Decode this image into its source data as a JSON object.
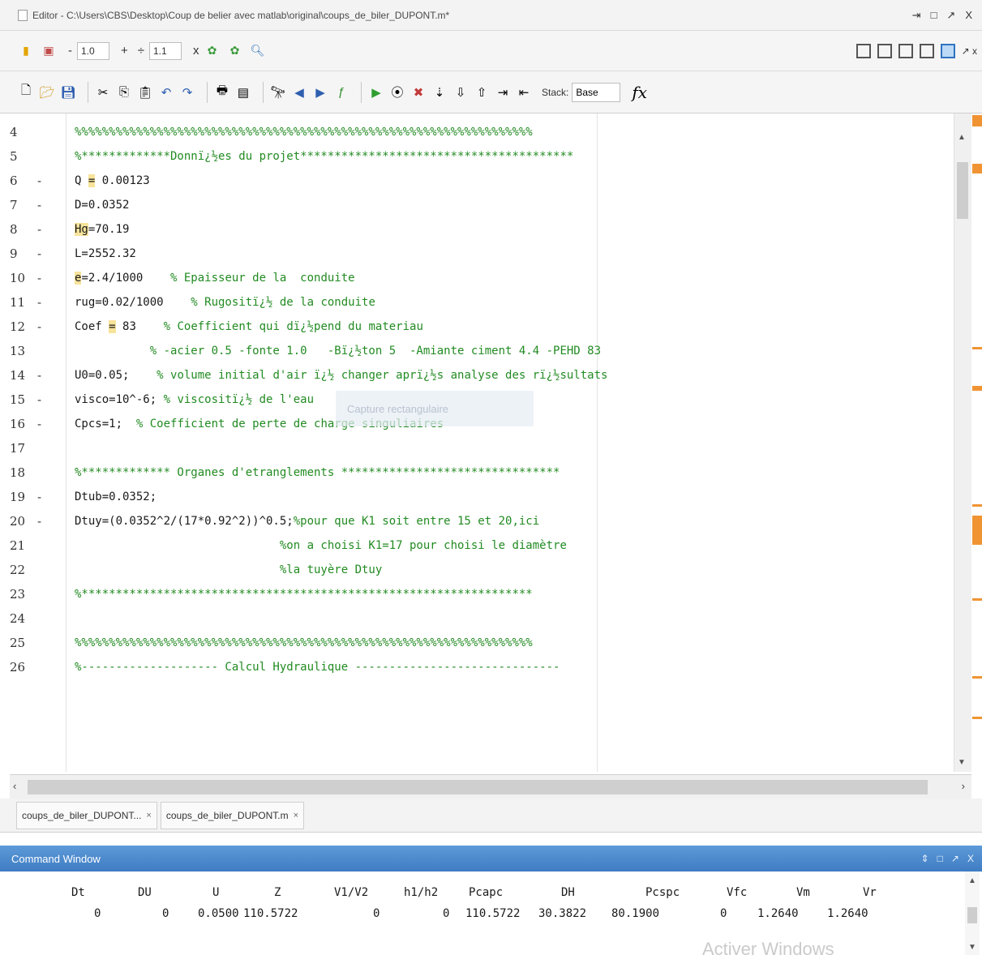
{
  "window": {
    "title": "Editor - C:\\Users\\CBS\\Desktop\\Coup de belier avec matlab\\original\\coups_de_biler_DUPONT.m*",
    "controls": [
      "⇥",
      "□",
      "↗",
      "X"
    ]
  },
  "toolbar_cell": {
    "minus": "-",
    "value1": "1.0",
    "plus": "+",
    "divide": "÷",
    "value2": "1.1",
    "times": "x"
  },
  "toolbar_main": {
    "stack_label": "Stack:",
    "stack_value": "Base",
    "fx": "fx"
  },
  "editor": {
    "gutter": [
      {
        "n": "4",
        "d": ""
      },
      {
        "n": "5",
        "d": ""
      },
      {
        "n": "6",
        "d": "-"
      },
      {
        "n": "7",
        "d": "-"
      },
      {
        "n": "8",
        "d": "-"
      },
      {
        "n": "9",
        "d": "-"
      },
      {
        "n": "10",
        "d": "-"
      },
      {
        "n": "11",
        "d": "-"
      },
      {
        "n": "12",
        "d": "-"
      },
      {
        "n": "13",
        "d": ""
      },
      {
        "n": "14",
        "d": "-"
      },
      {
        "n": "15",
        "d": "-"
      },
      {
        "n": "16",
        "d": "-"
      },
      {
        "n": "17",
        "d": ""
      },
      {
        "n": "18",
        "d": ""
      },
      {
        "n": "19",
        "d": "-"
      },
      {
        "n": "20",
        "d": "-"
      },
      {
        "n": "21",
        "d": ""
      },
      {
        "n": "22",
        "d": ""
      },
      {
        "n": "23",
        "d": ""
      },
      {
        "n": "24",
        "d": ""
      },
      {
        "n": "25",
        "d": ""
      },
      {
        "n": "26",
        "d": ""
      }
    ],
    "code": {
      "l4": "%%%%%%%%%%%%%%%%%%%%%%%%%%%%%%%%%%%%%%%%%%%%%%%%%%%%%%%%%%%%%%%%%%%",
      "l5": "%*************Donnï¿½es du projet****************************************",
      "l6a": "Q ",
      "l6b": "=",
      "l6c": " 0.00123",
      "l7": "D=0.0352",
      "l8a": "Hg",
      "l8b": "=70.19",
      "l9": "L=2552.32",
      "l10a": "e",
      "l10b": "=2.4/1000",
      "l10c": "    % Epaisseur de la  conduite",
      "l11a": "rug=0.02/1000",
      "l11b": "    % Rugositï¿½ de la conduite",
      "l12a": "Coef ",
      "l12b": "=",
      "l12c": " 83",
      "l12d": "    % Coefficient qui dï¿½pend du materiau",
      "l13": "           % -acier 0.5 -fonte 1.0   -Bï¿½ton 5  -Amiante ciment 4.4 -PEHD 83",
      "l14a": "U0=0.05;",
      "l14b": "    % volume initial d'air ï¿½ changer aprï¿½s analyse des rï¿½sultats",
      "l15a": "visco=10^-6;",
      "l15b": " % viscositï¿½ de l'eau",
      "l16a": "Cpcs=1;",
      "l16b": "  % Coefficient de perte de charge singuliaires",
      "l18": "%************* Organes d'etranglements ********************************",
      "l19": "Dtub=0.0352;",
      "l20a": "Dtuy=(0.0352^2/(17*0.92^2))^0.5;",
      "l20b": "%pour que K1 soit entre 15 et 20,ici",
      "l21": "                              %on a choisi K1=17 pour choisi le diamètre",
      "l22": "                              %la tuyère Dtuy",
      "l23": "%******************************************************************",
      "l25": "%%%%%%%%%%%%%%%%%%%%%%%%%%%%%%%%%%%%%%%%%%%%%%%%%%%%%%%%%%%%%%%%%%%",
      "l26": "%-------------------- Calcul Hydraulique ------------------------------"
    },
    "tooltip": "Capture rectangulaire"
  },
  "tabs": [
    {
      "label": "coups_de_biler_DUPONT...",
      "close": "×"
    },
    {
      "label": "coups_de_biler_DUPONT.m",
      "close": "×"
    }
  ],
  "command_window": {
    "title": "Command Window",
    "controls": [
      "⇕",
      "□",
      "↗",
      "X"
    ],
    "headers": [
      "Dt",
      "DU",
      "U",
      "Z",
      "V1/V2",
      "h1/h2",
      "Pcapc",
      "DH",
      "Pcspc",
      "Vfc",
      "Vm",
      "Vr"
    ],
    "row": [
      "0",
      "0",
      "0.0500",
      "110.5722",
      "0",
      "0",
      "110.5722",
      "30.3822",
      "80.1900",
      "0",
      "1.2640",
      "1.2640"
    ]
  },
  "watermark": "Activer Windows",
  "colors": {
    "comment": "#228b22",
    "highlight": "#f7e39a",
    "command_title": "#4f8bcf",
    "overview_marker": "#f09433"
  }
}
